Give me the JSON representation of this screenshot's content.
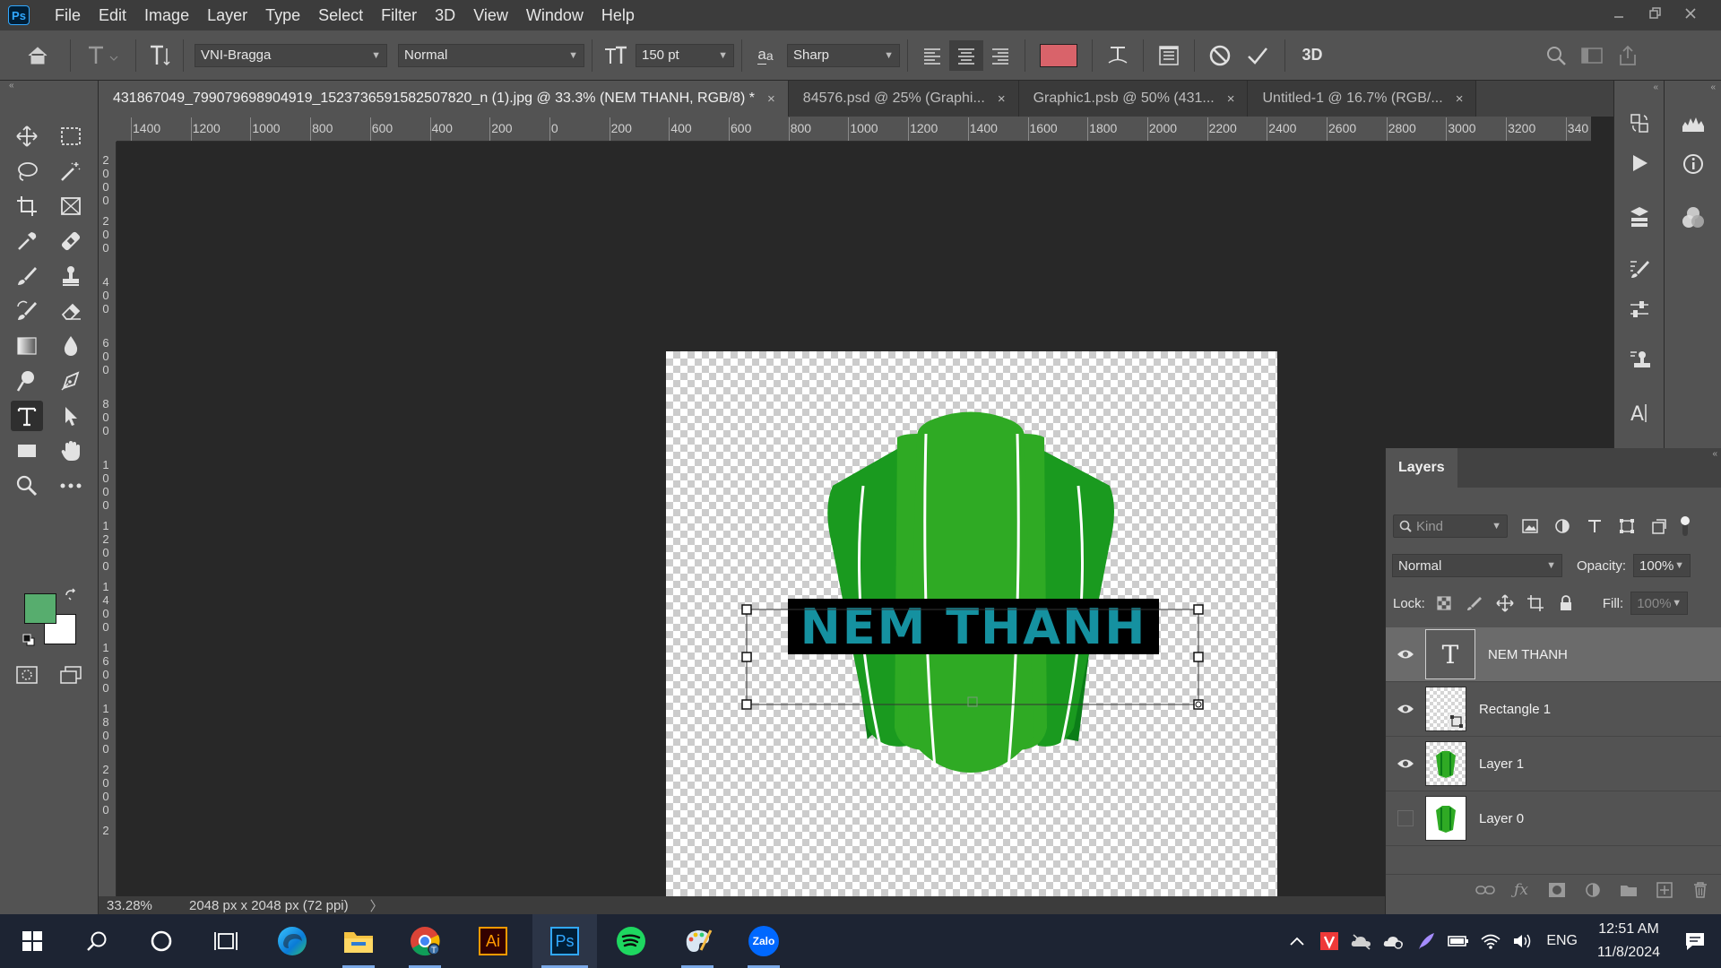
{
  "app": {
    "logo": "Ps"
  },
  "menu": [
    "File",
    "Edit",
    "Image",
    "Layer",
    "Type",
    "Select",
    "Filter",
    "3D",
    "View",
    "Window",
    "Help"
  ],
  "options": {
    "font_family": "VNI-Bragga",
    "font_style": "Normal",
    "font_size": "150 pt",
    "aa_label": "a",
    "antialias": "Sharp",
    "text_color": "#d9636a",
    "three_d_label": "3D"
  },
  "tabs": [
    {
      "label": "431867049_799079698904919_1523736591582507820_n (1).jpg @ 33.3% (NEM THANH, RGB/8) *",
      "close": "×"
    },
    {
      "label": "84576.psd @ 25% (Graphi...",
      "close": "×"
    },
    {
      "label": "Graphic1.psb @ 50% (431...",
      "close": "×"
    },
    {
      "label": "Untitled-1 @ 16.7% (RGB/...",
      "close": "×"
    }
  ],
  "ruler_h": [
    "1400",
    "1200",
    "1000",
    "800",
    "600",
    "400",
    "200",
    "0",
    "200",
    "400",
    "600",
    "800",
    "1000",
    "1200",
    "1400",
    "1600",
    "1800",
    "2000",
    "2200",
    "2400",
    "2600",
    "2800",
    "3000",
    "3200",
    "340"
  ],
  "ruler_v": [
    [
      "2",
      "0",
      "0",
      "0"
    ],
    [
      "2",
      "0",
      "0"
    ],
    [
      "4",
      "0",
      "0"
    ],
    [
      "6",
      "0",
      "0"
    ],
    [
      "8",
      "0",
      "0"
    ],
    [
      "1",
      "0",
      "0",
      "0"
    ],
    [
      "1",
      "2",
      "0",
      "0"
    ],
    [
      "1",
      "4",
      "0",
      "0"
    ],
    [
      "1",
      "6",
      "0",
      "0"
    ],
    [
      "1",
      "8",
      "0",
      "0"
    ],
    [
      "2",
      "0",
      "0",
      "0"
    ],
    [
      "2"
    ]
  ],
  "canvas": {
    "banner_text": "NEM THANH",
    "logo_color_dark": "#0b7d18",
    "logo_color_light": "#2faa24",
    "banner_text_color": "#1591a0"
  },
  "colors": {
    "foreground": "#57ad6e",
    "background": "#ffffff"
  },
  "status": {
    "zoom": "33.28%",
    "doc_size": "2048 px x 2048 px (72 ppi)",
    "arrow": "〉"
  },
  "layers_panel": {
    "tab": "Layers",
    "filter_placeholder": "Kind",
    "blend_mode": "Normal",
    "opacity_label": "Opacity:",
    "opacity": "100%",
    "lock_label": "Lock:",
    "fill_label": "Fill:",
    "fill": "100%",
    "layers": [
      {
        "name": "NEM THANH",
        "type": "text",
        "visible": true,
        "selected": true
      },
      {
        "name": "Rectangle 1",
        "type": "shape",
        "visible": true,
        "selected": false
      },
      {
        "name": "Layer 1",
        "type": "image",
        "visible": true,
        "selected": false
      },
      {
        "name": "Layer 0",
        "type": "image",
        "visible": false,
        "selected": false
      }
    ],
    "text_thumb": "T"
  },
  "taskbar": {
    "apps": [
      "windows-start",
      "search",
      "cortana",
      "task-view",
      "edge",
      "file-explorer",
      "chrome",
      "illustrator",
      "photoshop",
      "spotify",
      "paint",
      "zalo"
    ],
    "illustrator_label": "Ai",
    "photoshop_label": "Ps",
    "zalo_label": "Zalo",
    "lang": "ENG",
    "time": "12:51 AM",
    "date": "11/8/2024"
  }
}
